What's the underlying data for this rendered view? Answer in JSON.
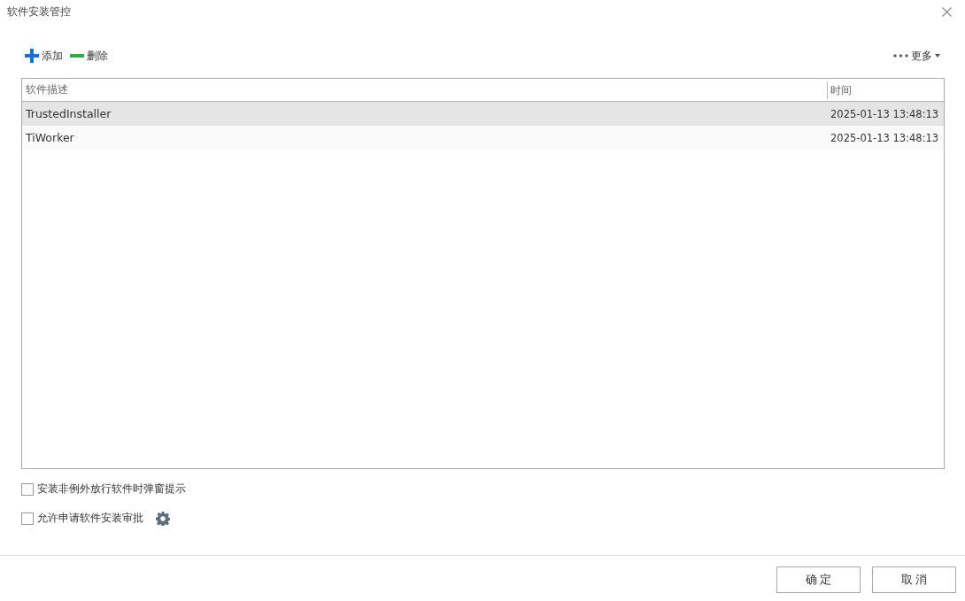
{
  "window": {
    "title": "软件安装管控"
  },
  "toolbar": {
    "add": "添加",
    "delete": "删除",
    "more": "更多"
  },
  "table": {
    "columns": [
      "软件描述",
      "时间"
    ],
    "rows": [
      {
        "description": "TrustedInstaller",
        "time": "2025-01-13 13:48:13",
        "selected": true
      },
      {
        "description": "TiWorker",
        "time": "2025-01-13 13:48:13",
        "selected": false
      }
    ]
  },
  "options": [
    {
      "label": "安装非例外放行软件时弹窗提示",
      "checked": false,
      "settings": false
    },
    {
      "label": "允许申请软件安装审批",
      "checked": false,
      "settings": true
    }
  ],
  "buttons": [
    "确 定",
    "取 消"
  ]
}
